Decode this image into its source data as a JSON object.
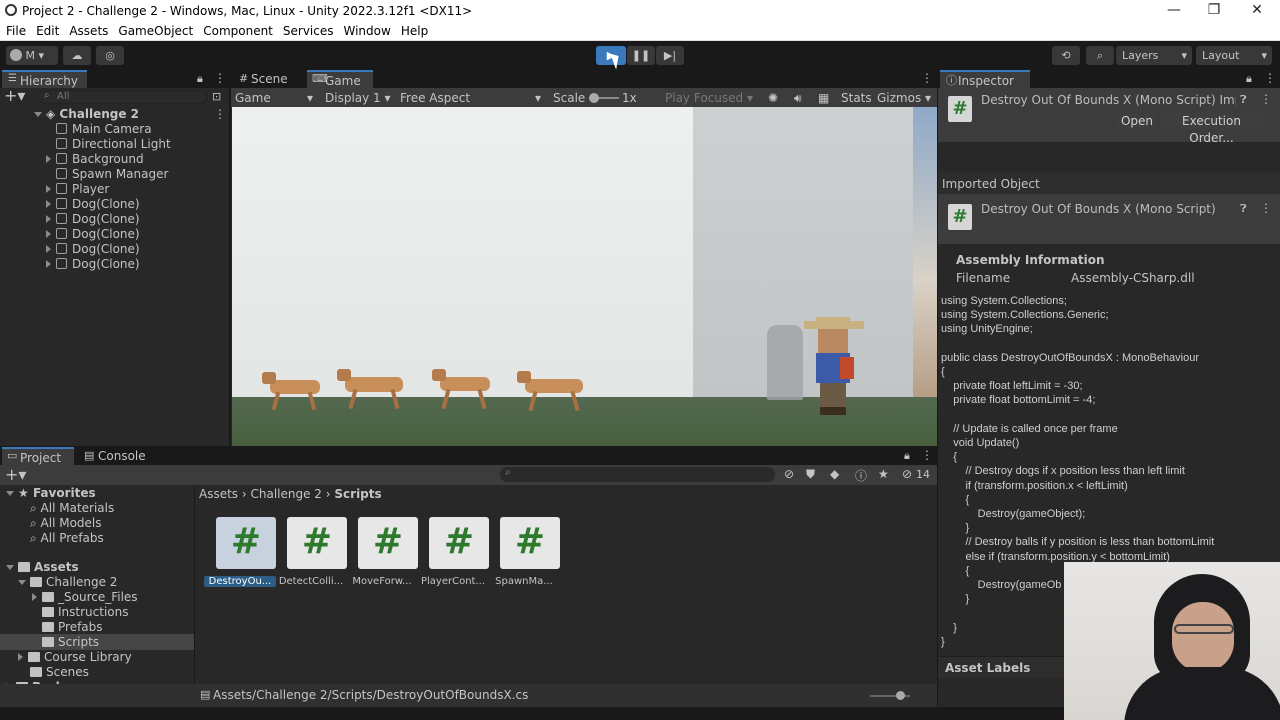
{
  "window": {
    "title": "Project 2 - Challenge 2 - Windows, Mac, Linux - Unity 2022.3.12f1 <DX11>"
  },
  "menu": [
    "File",
    "Edit",
    "Assets",
    "GameObject",
    "Component",
    "Services",
    "Window",
    "Help"
  ],
  "toolbar": {
    "account": "M",
    "layers": "Layers",
    "layout": "Layout"
  },
  "hierarchy": {
    "tab": "Hierarchy",
    "search_placeholder": "All",
    "scene": "Challenge 2",
    "items": [
      "Main Camera",
      "Directional Light",
      "Background",
      "Spawn Manager",
      "Player",
      "Dog(Clone)",
      "Dog(Clone)",
      "Dog(Clone)",
      "Dog(Clone)",
      "Dog(Clone)"
    ]
  },
  "game": {
    "tab_scene": "Scene",
    "tab_game": "Game",
    "mode": "Game",
    "display": "Display 1",
    "aspect": "Free Aspect",
    "scale_label": "Scale",
    "scale_value": "1x",
    "play_focused": "Play Focused",
    "stats": "Stats",
    "gizmos": "Gizmos"
  },
  "project": {
    "tab_project": "Project",
    "tab_console": "Console",
    "hidden_count": "14",
    "favorites": "Favorites",
    "fav_items": [
      "All Materials",
      "All Models",
      "All Prefabs"
    ],
    "assets": "Assets",
    "challenge": "Challenge 2",
    "folders": [
      "_Source_Files",
      "Instructions",
      "Prefabs",
      "Scripts"
    ],
    "course_library": "Course Library",
    "scenes": "Scenes",
    "packages": "Packages",
    "breadcrumb": [
      "Assets",
      "Challenge 2",
      "Scripts"
    ],
    "files": [
      "DestroyOu...",
      "DetectColli...",
      "MoveForw...",
      "PlayerCont...",
      "SpawnMa..."
    ],
    "status_path": "Assets/Challenge 2/Scripts/DestroyOutOfBoundsX.cs"
  },
  "inspector": {
    "tab": "Inspector",
    "title": "Destroy Out Of Bounds X (Mono Script) Imp",
    "open_btn": "Open",
    "exec_btn": "Execution Order...",
    "imported_object": "Imported Object",
    "sub_title": "Destroy Out Of Bounds X (Mono Script)",
    "assembly_info": "Assembly Information",
    "filename_label": "Filename",
    "filename_value": "Assembly-CSharp.dll",
    "code": "using System.Collections;\nusing System.Collections.Generic;\nusing UnityEngine;\n\npublic class DestroyOutOfBoundsX : MonoBehaviour\n{\n    private float leftLimit = -30;\n    private float bottomLimit = -4;\n\n    // Update is called once per frame\n    void Update()\n    {\n        // Destroy dogs if x position less than left limit\n        if (transform.position.x < leftLimit)\n        {\n            Destroy(gameObject);\n        }\n        // Destroy balls if y position is less than bottomLimit\n        else if (transform.position.y < bottomLimit)\n        {\n            Destroy(gameOb\n        }\n\n    }\n}",
    "asset_labels": "Asset Labels"
  },
  "colors": {
    "accent": "#3a79bb",
    "bg": "#191919",
    "panel": "#282828",
    "script_green": "#2d7a2d"
  }
}
